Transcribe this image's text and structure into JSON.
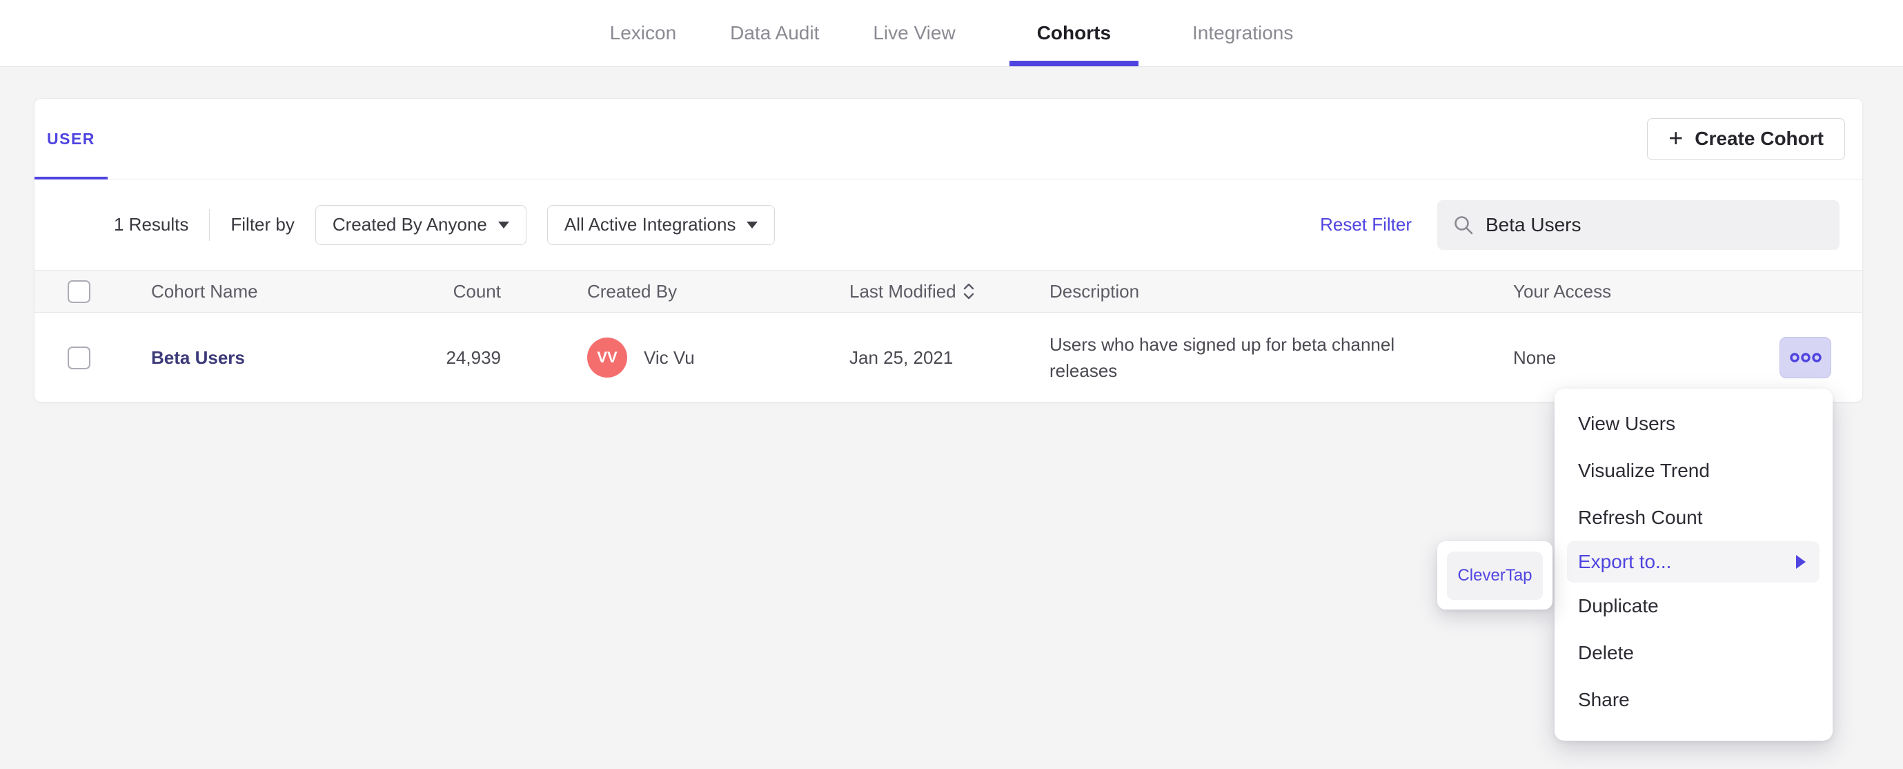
{
  "nav": {
    "items": [
      {
        "label": "Lexicon"
      },
      {
        "label": "Data Audit"
      },
      {
        "label": "Live View"
      },
      {
        "label": "Cohorts"
      },
      {
        "label": "Integrations"
      }
    ],
    "active": "Cohorts"
  },
  "cohorts": {
    "tab": "USER",
    "create_button": "Create Cohort",
    "plus_icon": "+",
    "results": "1 Results",
    "filter_by": "Filter by",
    "created_by_dropdown": "Created By Anyone",
    "integrations_dropdown": "All Active Integrations",
    "reset_filter": "Reset Filter",
    "search_value": "Beta Users"
  },
  "table": {
    "headers": {
      "name": "Cohort Name",
      "count": "Count",
      "created_by": "Created By",
      "last_modified": "Last Modified",
      "description": "Description",
      "access": "Your Access"
    },
    "rows": [
      {
        "name": "Beta Users",
        "count": "24,939",
        "avatar_initials": "VV",
        "created_by": "Vic Vu",
        "last_modified": "Jan 25, 2021",
        "description": "Users who have signed up for beta channel releases",
        "access": "None"
      }
    ]
  },
  "context_menu": {
    "items": [
      {
        "label": "View Users"
      },
      {
        "label": "Visualize Trend"
      },
      {
        "label": "Refresh Count"
      },
      {
        "label": "Export to...",
        "active": true,
        "has_submenu": true
      },
      {
        "label": "Duplicate"
      },
      {
        "label": "Delete"
      },
      {
        "label": "Share"
      }
    ]
  },
  "export_submenu": {
    "items": [
      {
        "label": "CleverTap"
      }
    ]
  },
  "colors": {
    "accent": "#4f44e0",
    "avatar_bg": "#f56e6e",
    "cohort_link": "#3d3a78",
    "page_bg": "#f4f4f5"
  }
}
